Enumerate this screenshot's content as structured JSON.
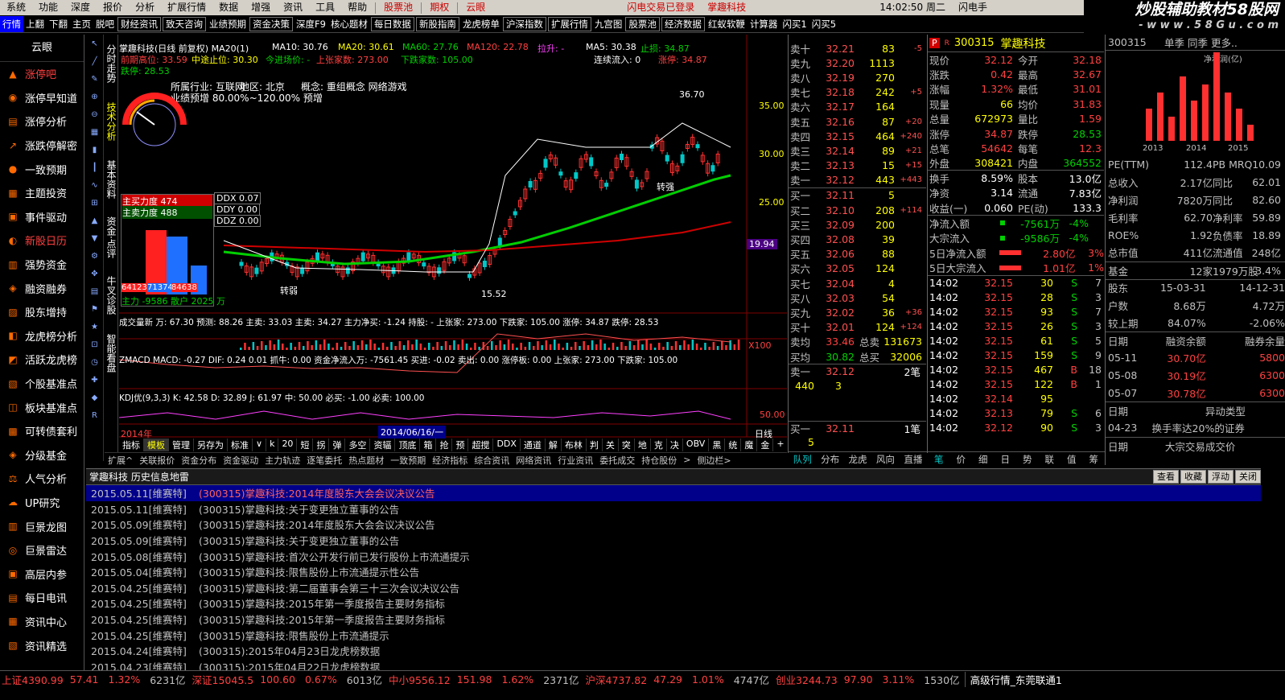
{
  "menu": [
    "系统",
    "功能",
    "深度",
    "报价",
    "分析",
    "扩展行情",
    "数据",
    "增强",
    "资讯",
    "工具",
    "帮助"
  ],
  "menu_tags": [
    "股票池",
    "期权",
    "云眼"
  ],
  "menu_status": "闪电交易已登录",
  "menu_stock": "掌趣科技",
  "menu_time": "14:02:50 周二",
  "menu_right": "闪电手",
  "toolbar": [
    "行情",
    "上翻",
    "下翻",
    "主页",
    "脱吧",
    "财经资讯",
    "致天咨询",
    "业绩预期",
    "资金决策",
    "深度F9",
    "核心题材",
    "每日数据",
    "新股指南",
    "龙虎榜单",
    "沪深指数",
    "扩展行情",
    "九宫图",
    "股票池",
    "经济数据",
    "红蚁软鞭",
    "计算器",
    "闪买1",
    "闪买5",
    "闪买1",
    "闪买5",
    "张停买",
    "涨停"
  ],
  "watermark": {
    "title": "炒股辅助教材58股网",
    "sub": "- w w w . 5 8 G u . c o m"
  },
  "sidebar": {
    "title": "云眼",
    "items": [
      "涨停吧",
      "涨停早知道",
      "涨停分析",
      "涨跌停解密",
      "一致预期",
      "主题投资",
      "事件驱动",
      "新股日历",
      "强势资金",
      "融资融券",
      "股东增持",
      "龙虎榜分析",
      "活跃龙虎榜",
      "个股基准点",
      "板块基准点",
      "可转债套利",
      "分级基金",
      "人气分析",
      "UP研究",
      "巨景龙图",
      "巨景雷达",
      "高层内参",
      "每日电讯",
      "资讯中心",
      "资讯精选"
    ]
  },
  "vtabs": [
    "分时走势",
    "技术分析",
    "基本资料",
    "资金·点评",
    "牛叉诊股",
    "智能看盘"
  ],
  "chart": {
    "title": "掌趣科技(日线 前复权) MA20(1)",
    "ma10": "MA10: 30.76",
    "ma20": "MA20: 30.61",
    "ma60": "MA60: 27.76",
    "ma120": "MA120: 22.78",
    "lashang": "拉升: -",
    "ma5": "MA5: 30.38",
    "lianxu": "连续流入: 0",
    "zhiying": "止损: 34.87",
    "zhisun": "涨停: 34.87",
    "qianqi": "前期高位: 33.59",
    "zhongtu": "中途止位: 30.30",
    "jinri": "今进场价: -",
    "shangzhang": "上张家数: 273.00",
    "xiadie": "下跌家数: 105.00",
    "dieting": "跌停: 28.53",
    "hangye": "所属行业: 互联网",
    "diqu": "地区: 北京",
    "gainian": "概念: 重组概念 网络游戏",
    "yugao": "业绩预增 80.00%~120.00%  预增",
    "gauge_label": "主升浪",
    "zhuli_in": "主买力度 474",
    "zhuli_out": "主卖力度 488",
    "ddx": "DDX 0.07",
    "ddy": "DDY 0.00",
    "ddz": "DDZ 0.00",
    "zhuli_net": "主力 -9586 散户 2025 万",
    "bar_vals": [
      "64123",
      "71374",
      "84638",
      "3261",
      "37561"
    ],
    "price_axis": [
      "35.00",
      "30.00",
      "25.00"
    ],
    "cur_price": "19.94",
    "hi_label": "36.70",
    "lo_label": "15.52",
    "zhuanqiang": "转强",
    "zhuanruo": "转弱",
    "vol_line": "成交量新 万: 67.30  预测: 88.26  主卖: 33.03  主卖: 34.27  主力净买: -1.24  持股: -  上张家: 273.00  下跌家: 105.00  涨停: 34.87  跌停: 28.53",
    "macd_line": "ZMACD MACD: -0.27  DIF: 0.24  0.01  抓牛: 0.00  资金净流入万: -7561.45  买进: -0.02  卖出: 0.00  涨停板: 0.00  上张家: 273.00  下跌家: 105.00",
    "kdj_line": "KDJ优(9,3,3) K: 42.58  D: 32.89  J: 61.97   中: 50.00  必买: -1.00  必卖: 100.00",
    "x100": "X100",
    "kdj_scale": "50.00",
    "date_l": "2014年",
    "date_sel": "2014/06/16/一",
    "rixian": "日线"
  },
  "ind_tabs": [
    "指标",
    "模板",
    "管理",
    "另存为",
    "标准",
    "∨",
    "k",
    "20",
    "短",
    "拐",
    "弹",
    "多空",
    "资辐",
    "顶底",
    "箱",
    "抢",
    "预",
    "超搅",
    "DDX",
    "通道",
    "解",
    "布林",
    "判",
    "关",
    "突",
    "地",
    "克",
    "决",
    "OBV",
    "黑",
    "统",
    "魔",
    "金",
    "+",
    "-",
    "0"
  ],
  "bot_tabs": [
    "扩展^",
    "关联报价",
    "资金分布",
    "资金驱动",
    "主力轨迹",
    "逐笔委托",
    "热点题材",
    "一致预期",
    "经济指标",
    "综合资讯",
    "网络资讯",
    "行业资讯",
    "委托成交",
    "持仓股份",
    ">",
    "侧边栏>"
  ],
  "quote": {
    "sell": [
      {
        "l": "卖十",
        "p": "32.21",
        "v": "83",
        "c": "-5"
      },
      {
        "l": "卖九",
        "p": "32.20",
        "v": "1113",
        "c": ""
      },
      {
        "l": "卖八",
        "p": "32.19",
        "v": "270",
        "c": ""
      },
      {
        "l": "卖七",
        "p": "32.18",
        "v": "242",
        "c": "+5"
      },
      {
        "l": "卖六",
        "p": "32.17",
        "v": "164",
        "c": ""
      },
      {
        "l": "卖五",
        "p": "32.16",
        "v": "87",
        "c": "+20"
      },
      {
        "l": "卖四",
        "p": "32.15",
        "v": "464",
        "c": "+240"
      },
      {
        "l": "卖三",
        "p": "32.14",
        "v": "89",
        "c": "+21"
      },
      {
        "l": "卖二",
        "p": "32.13",
        "v": "15",
        "c": "+15"
      },
      {
        "l": "卖一",
        "p": "32.12",
        "v": "443",
        "c": "+443"
      }
    ],
    "buy": [
      {
        "l": "买一",
        "p": "32.11",
        "v": "5",
        "c": ""
      },
      {
        "l": "买二",
        "p": "32.10",
        "v": "208",
        "c": "+114"
      },
      {
        "l": "买三",
        "p": "32.09",
        "v": "200",
        "c": ""
      },
      {
        "l": "买四",
        "p": "32.08",
        "v": "39",
        "c": ""
      },
      {
        "l": "买五",
        "p": "32.06",
        "v": "88",
        "c": ""
      },
      {
        "l": "买六",
        "p": "32.05",
        "v": "124",
        "c": ""
      },
      {
        "l": "买七",
        "p": "32.04",
        "v": "4",
        "c": ""
      },
      {
        "l": "买八",
        "p": "32.03",
        "v": "54",
        "c": ""
      },
      {
        "l": "买九",
        "p": "32.02",
        "v": "36",
        "c": "+36"
      },
      {
        "l": "买十",
        "p": "32.01",
        "v": "124",
        "c": "+124"
      }
    ],
    "avg_sell_l": "卖均",
    "avg_sell": "33.46",
    "tot_sell_l": "总卖",
    "tot_sell": "131673",
    "avg_buy_l": "买均",
    "avg_buy": "30.82",
    "tot_buy_l": "总买",
    "tot_buy": "32006",
    "s1_l": "卖一",
    "s1_p": "32.12",
    "s1_n": "2笔",
    "s1_a": "440",
    "s1_b": "3",
    "b1_l": "买一",
    "b1_p": "32.11",
    "b1_n": "1笔",
    "b1_a": "5",
    "tabs": [
      "队列",
      "分布",
      "龙虎",
      "风向",
      "直播"
    ]
  },
  "info": {
    "code": "300315",
    "name": "掌趣科技",
    "flag": "R",
    "rows": [
      [
        "现价",
        "32.12",
        "今开",
        "32.18"
      ],
      [
        "涨跌",
        "0.42",
        "最高",
        "32.67"
      ],
      [
        "涨幅",
        "1.32%",
        "最低",
        "31.01"
      ],
      [
        "现量",
        "66",
        "均价",
        "31.83"
      ],
      [
        "总量",
        "672973",
        "量比",
        "1.59"
      ],
      [
        "涨停",
        "34.87",
        "跌停",
        "28.53"
      ],
      [
        "总笔",
        "54642",
        "每笔",
        "12.3"
      ],
      [
        "外盘",
        "308421",
        "内盘",
        "364552"
      ],
      [
        "换手",
        "8.59%",
        "股本",
        "13.0亿"
      ],
      [
        "净资",
        "3.14",
        "流通",
        "7.83亿"
      ],
      [
        "收益(一)",
        "0.060",
        "PE(动)",
        "133.3"
      ]
    ],
    "flows": [
      [
        "净流入额",
        "-7561万",
        "-4%"
      ],
      [
        "大宗流入",
        "-9586万",
        "-4%"
      ],
      [
        "5日净流入额",
        "2.80亿",
        "3%"
      ],
      [
        "5日大宗流入",
        "1.01亿",
        "1%"
      ]
    ],
    "ticks": [
      [
        "14:02",
        "32.15",
        "30",
        "S",
        "7"
      ],
      [
        "14:02",
        "32.15",
        "28",
        "S",
        "3"
      ],
      [
        "14:02",
        "32.15",
        "93",
        "S",
        "7"
      ],
      [
        "14:02",
        "32.15",
        "26",
        "S",
        "3"
      ],
      [
        "14:02",
        "32.15",
        "61",
        "S",
        "5"
      ],
      [
        "14:02",
        "32.15",
        "159",
        "S",
        "9"
      ],
      [
        "14:02",
        "32.15",
        "467",
        "B",
        "18"
      ],
      [
        "14:02",
        "32.15",
        "122",
        "B",
        "1"
      ],
      [
        "14:02",
        "32.14",
        "95",
        "",
        ""
      ],
      [
        "14:02",
        "32.13",
        "79",
        "S",
        "6"
      ],
      [
        "14:02",
        "32.12",
        "90",
        "S",
        "3"
      ]
    ],
    "tabs": [
      "笔",
      "价",
      "细",
      "日",
      "势",
      "联",
      "值",
      "筹"
    ]
  },
  "right": {
    "code": "300315",
    "tabs_hd": "单季 同季 更多..",
    "chart_label": "净利润(亿)",
    "years": [
      "2013",
      "2014",
      "2015"
    ],
    "rows": [
      [
        "PE(TTM)",
        "112.4",
        "PB MRQ",
        "10.09"
      ],
      [
        "总收入",
        "2.17亿",
        "同比",
        "62.01"
      ],
      [
        "净利润",
        "7820万",
        "同比",
        "82.60"
      ],
      [
        "毛利率",
        "62.70",
        "净利率",
        "59.89"
      ],
      [
        "ROE%",
        "1.92",
        "负债率",
        "18.89"
      ],
      [
        "总市值",
        "411亿",
        "流通值",
        "248亿"
      ],
      [
        "基金",
        "12家",
        "1979万股",
        "3.4%"
      ],
      [
        "股东",
        "15-03-31",
        "",
        "14-12-31"
      ],
      [
        "户数",
        "8.68万",
        "",
        "4.72万"
      ],
      [
        "较上期",
        "84.07%",
        "",
        "-2.06%"
      ],
      [
        "日期",
        "融资余额",
        "",
        "融券余量"
      ],
      [
        "05-11",
        "30.70亿",
        "",
        "5800"
      ],
      [
        "05-08",
        "30.19亿",
        "",
        "6300"
      ],
      [
        "05-07",
        "30.78亿",
        "",
        "6300"
      ],
      [
        "日期",
        "",
        "异动类型",
        ""
      ],
      [
        "04-23",
        "换手率达20%的证券",
        "",
        ""
      ],
      [
        "日期",
        "大宗交易",
        "成交价",
        ""
      ]
    ]
  },
  "news": {
    "title": "掌趣科技 历史信息地雷",
    "buttons": [
      "查看",
      "收藏",
      "浮动",
      "关闭"
    ],
    "items": [
      [
        "2015.05.11[维赛特]",
        "(300315)掌趣科技:2014年度股东大会会议决议公告"
      ],
      [
        "2015.05.11[维赛特]",
        "(300315)掌趣科技:关于变更独立董事的公告"
      ],
      [
        "2015.05.09[维赛特]",
        "(300315)掌趣科技:2014年度股东大会会议决议公告"
      ],
      [
        "2015.05.09[维赛特]",
        "(300315)掌趣科技:关于变更独立董事的公告"
      ],
      [
        "2015.05.08[维赛特]",
        "(300315)掌趣科技:首次公开发行前已发行股份上市流通提示"
      ],
      [
        "2015.05.04[维赛特]",
        "(300315)掌趣科技:限售股份上市流通提示性公告"
      ],
      [
        "2015.04.25[维赛特]",
        "(300315)掌趣科技:第二届董事会第三十三次会议决议公告"
      ],
      [
        "2015.04.25[维赛特]",
        "(300315)掌趣科技:2015年第一季度报告主要财务指标"
      ],
      [
        "2015.04.25[维赛特]",
        "(300315)掌趣科技:2015年第一季度报告主要财务指标"
      ],
      [
        "2015.04.25[维赛特]",
        "(300315)掌趣科技:限售股份上市流通提示"
      ],
      [
        "2015.04.24[维赛特]",
        "(300315):2015年04月23日龙虎榜数据"
      ],
      [
        "2015.04.23[维赛特]",
        "(300315):2015年04月22日龙虎榜数据"
      ]
    ]
  },
  "status": {
    "sh": "上证4390.99",
    "sh_c": "57.41",
    "sh_p": "1.32%",
    "sh_v": "6231亿",
    "sz": "深证15045.5",
    "sz_c": "100.60",
    "sz_p": "0.67%",
    "sz_v": "6013亿",
    "zx": "中小9556.12",
    "zx_c": "151.98",
    "zx_p": "1.62%",
    "zx_v": "2371亿",
    "hs": "沪深4737.82",
    "hs_c": "47.29",
    "hs_p": "1.01%",
    "hs_v": "4747亿",
    "cy": "创业3244.73",
    "cy_c": "97.90",
    "cy_p": "3.11%",
    "cy_v": "1530亿",
    "srv": "高级行情_东莞联通1"
  }
}
